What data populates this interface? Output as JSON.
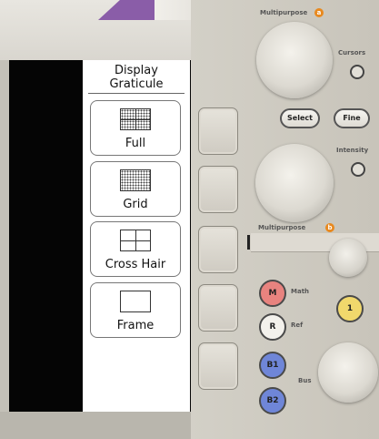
{
  "menu": {
    "title_line1": "Display",
    "title_line2": "Graticule",
    "items": [
      {
        "label": "Full",
        "icon": "full-graticule-icon"
      },
      {
        "label": "Grid",
        "icon": "grid-graticule-icon"
      },
      {
        "label": "Cross Hair",
        "icon": "crosshair-graticule-icon"
      },
      {
        "label": "Frame",
        "icon": "frame-graticule-icon"
      }
    ]
  },
  "panel": {
    "multipurpose_a_label": "Multipurpose",
    "multipurpose_a_badge": "a",
    "multipurpose_b_label": "Multipurpose",
    "multipurpose_b_badge": "b",
    "cursors_label": "Cursors",
    "select_label": "Select",
    "fine_label": "Fine",
    "intensity_label": "Intensity",
    "math_button": "M",
    "math_label": "Math",
    "ref_button": "R",
    "ref_label": "Ref",
    "ch1_button": "1",
    "bus1_button": "B1",
    "bus2_button": "B2",
    "bus_label": "Bus"
  },
  "colors": {
    "math_button": "#e8837f",
    "ref_button": "#f3f1ec",
    "ch1_button": "#f1d86c",
    "bus_button": "#6f86d8",
    "badge": "#e8891f"
  }
}
